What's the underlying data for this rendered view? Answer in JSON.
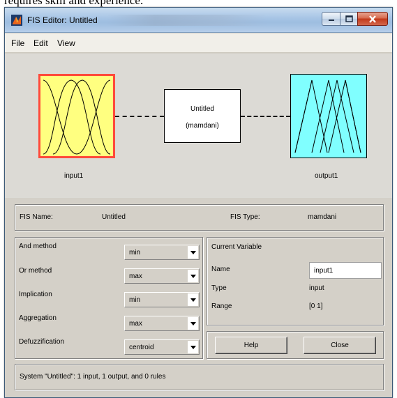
{
  "caption": "requires skill and experience.",
  "window": {
    "title": "FIS Editor: Untitled",
    "controls": [
      "minimize-icon",
      "maximize-icon",
      "close-icon"
    ]
  },
  "menu": [
    "File",
    "Edit",
    "View"
  ],
  "diagram": {
    "input_label": "input1",
    "output_label": "output1",
    "system_name": "Untitled",
    "system_type": "(mamdani)",
    "input_color": "#ffff80",
    "input_border": "#ff4a3a",
    "output_color": "#80ffff"
  },
  "fis": {
    "name_label": "FIS Name:",
    "name_value": "Untitled",
    "type_label": "FIS Type:",
    "type_value": "mamdani"
  },
  "methods": [
    {
      "label": "And method",
      "value": "min"
    },
    {
      "label": "Or method",
      "value": "max"
    },
    {
      "label": "Implication",
      "value": "min"
    },
    {
      "label": "Aggregation",
      "value": "max"
    },
    {
      "label": "Defuzzification",
      "value": "centroid"
    }
  ],
  "current_variable": {
    "heading": "Current Variable",
    "name_label": "Name",
    "name_value": "input1",
    "type_label": "Type",
    "type_value": "input",
    "range_label": "Range",
    "range_value": "[0 1]"
  },
  "buttons": {
    "help": "Help",
    "close": "Close"
  },
  "status": "System \"Untitled\": 1 input, 1 output, and 0 rules"
}
